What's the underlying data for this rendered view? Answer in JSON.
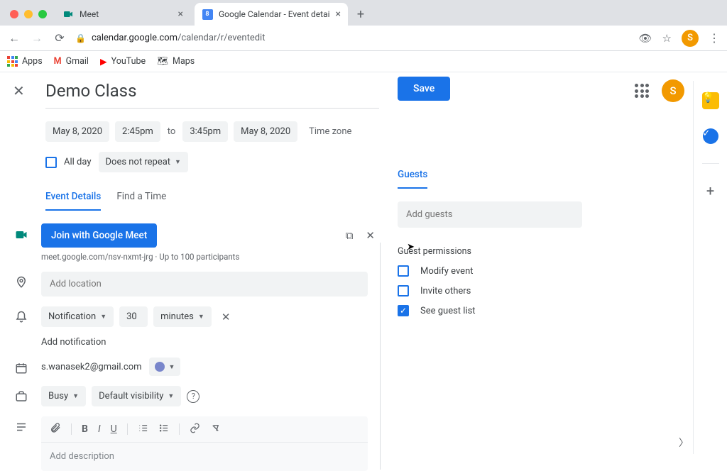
{
  "browser": {
    "tabs": [
      {
        "label": "Meet"
      },
      {
        "label": "Google Calendar - Event detai"
      }
    ],
    "url_host": "calendar.google.com",
    "url_path": "/calendar/r/eventedit",
    "cal_fav": "8",
    "bookmarks": {
      "apps": "Apps",
      "gmail": "Gmail",
      "youtube": "YouTube",
      "maps": "Maps"
    },
    "avatar_initial": "S"
  },
  "event": {
    "title": "Demo Class",
    "save": "Save",
    "start_date": "May 8, 2020",
    "start_time": "2:45pm",
    "to": "to",
    "end_time": "3:45pm",
    "end_date": "May 8, 2020",
    "timezone": "Time zone",
    "all_day": "All day",
    "repeat": "Does not repeat"
  },
  "tabs": {
    "event_details": "Event Details",
    "find_time": "Find a Time"
  },
  "meet": {
    "button": "Join with Google Meet",
    "link": "meet.google.com/nsv-nxmt-jrg",
    "sep": " · ",
    "participants": "Up to 100 participants"
  },
  "location": {
    "placeholder": "Add location"
  },
  "notification": {
    "type": "Notification",
    "value": "30",
    "unit": "minutes",
    "add": "Add notification"
  },
  "calendar": {
    "email": "s.wanasek2@gmail.com"
  },
  "visibility": {
    "busy": "Busy",
    "default": "Default visibility"
  },
  "description": {
    "placeholder": "Add description"
  },
  "guests": {
    "tab": "Guests",
    "placeholder": "Add guests",
    "permissions_title": "Guest permissions",
    "modify": "Modify event",
    "invite": "Invite others",
    "see_list": "See guest list"
  }
}
